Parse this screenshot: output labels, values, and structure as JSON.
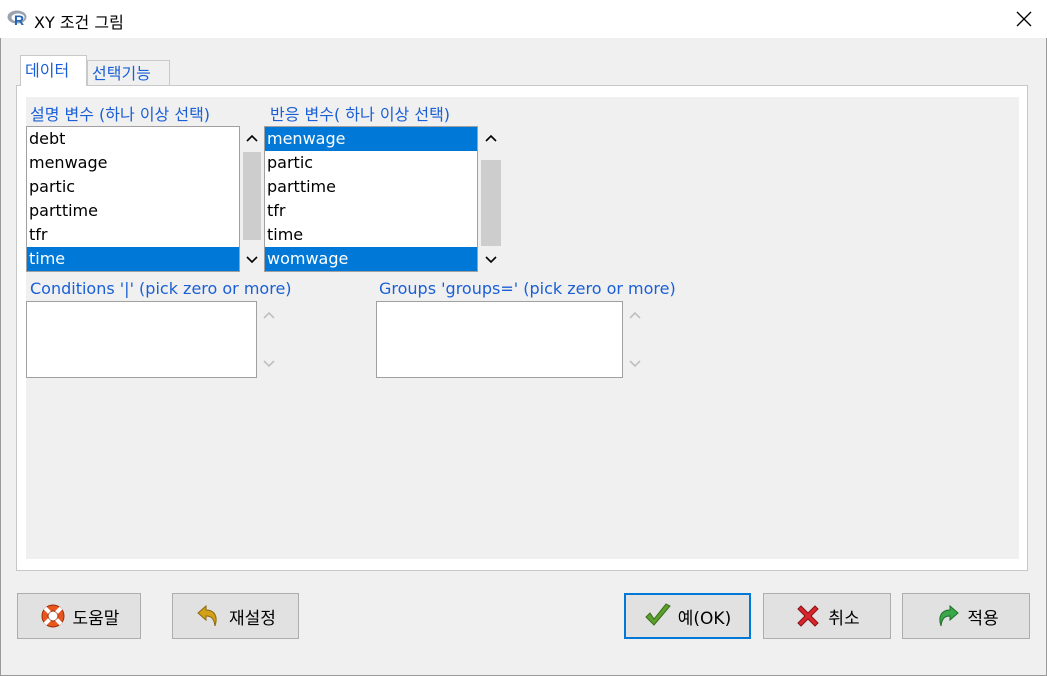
{
  "window": {
    "title": "XY 조건 그림"
  },
  "tabs": [
    {
      "label": "데이터",
      "active": true
    },
    {
      "label": "선택기능",
      "active": false
    }
  ],
  "explanatory": {
    "label": "설명 변수 (하나 이상 선택)",
    "items": [
      "debt",
      "menwage",
      "partic",
      "parttime",
      "tfr",
      "time"
    ],
    "selected": [
      "time"
    ]
  },
  "response": {
    "label": "반응 변수( 하나 이상 선택)",
    "items": [
      "menwage",
      "partic",
      "parttime",
      "tfr",
      "time",
      "womwage"
    ],
    "selected": [
      "menwage",
      "womwage"
    ]
  },
  "conditions": {
    "label": "Conditions '|' (pick zero or more)",
    "items": []
  },
  "groups": {
    "label": "Groups 'groups=' (pick zero or more)",
    "items": []
  },
  "buttons": {
    "help": "도움말",
    "reset": "재설정",
    "ok": "예(OK)",
    "cancel": "취소",
    "apply": "적용"
  },
  "colors": {
    "accent": "#1a5fd6",
    "selection": "#0078d7",
    "help_icon": "#e8561e",
    "reset_icon": "#d4a017",
    "ok_icon": "#5aa02c",
    "cancel_icon": "#d9262c",
    "apply_icon": "#3aa84a"
  },
  "icons": {
    "app": "r-logo-icon",
    "close": "close-icon",
    "help": "lifebuoy-icon",
    "reset": "undo-arrow-icon",
    "ok": "checkmark-icon",
    "cancel": "x-icon",
    "apply": "redo-arrow-icon"
  }
}
